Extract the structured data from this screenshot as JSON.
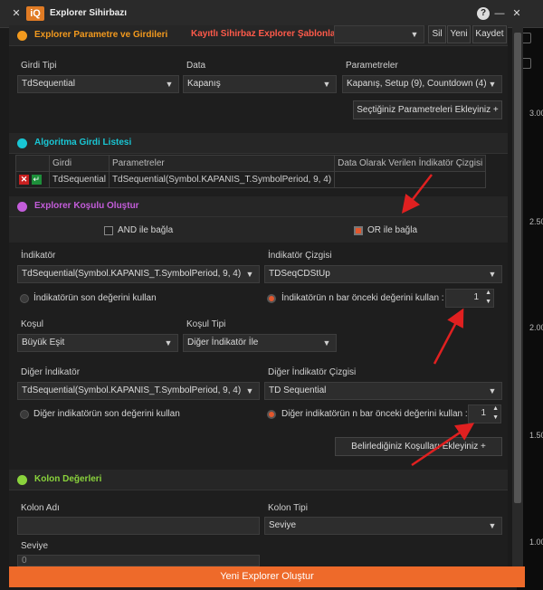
{
  "window": {
    "app_logo": "iQ",
    "title": "Explorer Sihirbazı",
    "close": "✕",
    "help": "?",
    "minimize": "—",
    "maximize": "□"
  },
  "params_section": {
    "title": "Explorer Parametre ve Girdileri",
    "templates_label": "Kayıtlı Sihirbaz Explorer Şablonları",
    "template_value": "",
    "delete_btn": "Sil",
    "new_btn": "Yeni",
    "save_btn": "Kaydet",
    "input_type_label": "Girdi Tipi",
    "input_type_value": "TdSequential",
    "data_label": "Data",
    "data_value": "Kapanış",
    "parameters_label": "Parametreler",
    "parameters_value": "Kapanış, Setup (9), Countdown (4)",
    "add_params_btn": "Seçtiğiniz Parametreleri Ekleyiniz"
  },
  "algo_section": {
    "title": "Algoritma Girdi Listesi",
    "columns": [
      "Girdi",
      "Parametreler",
      "Data Olarak Verilen İndikatör Çizgisi"
    ],
    "rows": [
      {
        "girdi": "TdSequential",
        "parametreler": "TdSequential(Symbol.KAPANIS_T.SymbolPeriod, 9, 4)",
        "cizgi": ""
      }
    ]
  },
  "condition_section": {
    "title": "Explorer Koşulu Oluştur",
    "and_label": "AND ile bağla",
    "or_label": "OR ile bağla",
    "indicator_label": "İndikatör",
    "indicator_value": "TdSequential(Symbol.KAPANIS_T.SymbolPeriod, 9, 4)",
    "indicator_line_label": "İndikatör Çizgisi",
    "indicator_line_value": "TDSeqCDStUp",
    "last_value_label": "İndikatörün son değerini kullan",
    "n_bar_label": "İndikatörün n bar önceki değerini kullan :",
    "n_bar_value": "1",
    "condition_label": "Koşul",
    "condition_value": "Büyük Eşit",
    "condition_type_label": "Koşul Tipi",
    "condition_type_value": "Diğer İndikatör İle",
    "other_indicator_label": "Diğer İndikatör",
    "other_indicator_value": "TdSequential(Symbol.KAPANIS_T.SymbolPeriod, 9, 4)",
    "other_line_label": "Diğer İndikatör Çizgisi",
    "other_line_value": "TD Sequential",
    "other_last_label": "Diğer indikatörün son değerini kullan",
    "other_n_bar_label": "Diğer indikatörün n bar önceki değerini kullan :",
    "other_n_bar_value": "1",
    "add_conditions_btn": "Belirlediğiniz Koşulları Ekleyiniz"
  },
  "column_section": {
    "title": "Kolon Değerleri",
    "col_name_label": "Kolon Adı",
    "col_name_value": "",
    "col_type_label": "Kolon Tipi",
    "col_type_value": "Seviye",
    "level_label": "Seviye",
    "level_value": "0"
  },
  "footer": {
    "create_btn": "Yeni Explorer Oluştur"
  },
  "background_chart": {
    "y_labels": [
      "3.00",
      "2.50",
      "2.00",
      "1.50",
      "1.00"
    ]
  },
  "colors": {
    "accent_orange": "#ee6a2a",
    "section1": "#f39a1e",
    "section2": "#19c6d4",
    "section3": "#c45ddb",
    "section4": "#8ad33c",
    "templates_red": "#ff5a4a",
    "arrow_red": "#e02020"
  },
  "icons": {
    "delete": "x-icon",
    "edit": "edit-icon",
    "plus": "plus-icon",
    "dropdown": "chevron-down-icon"
  }
}
